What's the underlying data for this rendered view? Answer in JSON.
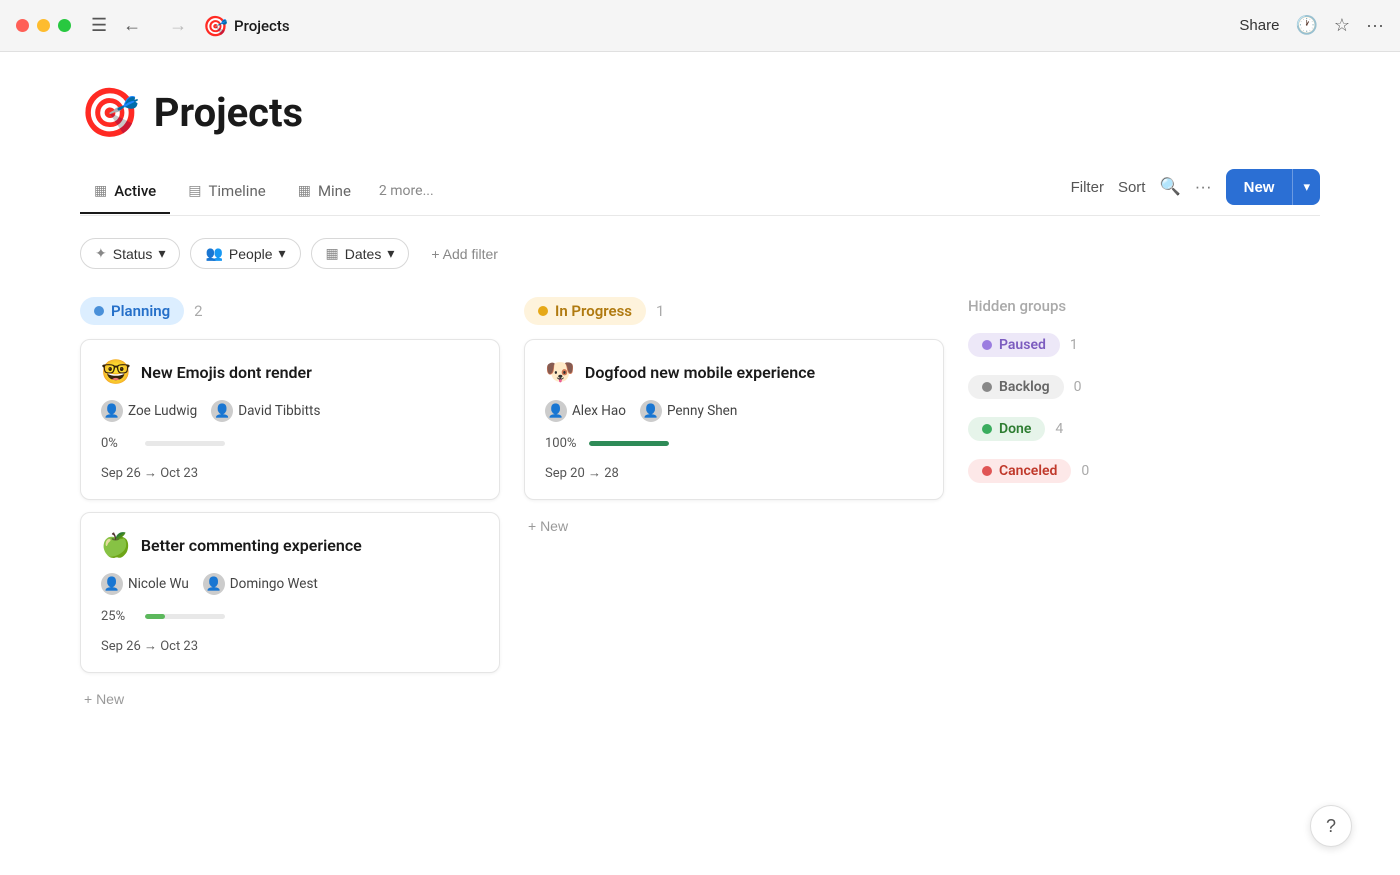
{
  "titlebar": {
    "app_icon": "🎯",
    "title": "Projects",
    "share_label": "Share",
    "history_icon": "🕐",
    "star_icon": "☆",
    "more_icon": "···"
  },
  "page": {
    "icon": "🎯",
    "title": "Projects"
  },
  "tabs": [
    {
      "id": "active",
      "label": "Active",
      "icon": "▦",
      "active": true
    },
    {
      "id": "timeline",
      "label": "Timeline",
      "icon": "▤"
    },
    {
      "id": "mine",
      "label": "Mine",
      "icon": "▦"
    },
    {
      "id": "more",
      "label": "2 more..."
    }
  ],
  "toolbar": {
    "filter_label": "Filter",
    "sort_label": "Sort",
    "search_icon": "🔍",
    "more_icon": "···",
    "new_label": "New",
    "chevron": "▾"
  },
  "filters": {
    "status_label": "Status",
    "people_label": "People",
    "dates_label": "Dates",
    "add_filter_label": "+ Add filter"
  },
  "columns": [
    {
      "id": "planning",
      "badge_label": "Planning",
      "count": 2,
      "cards": [
        {
          "emoji": "🤓",
          "title": "New Emojis dont  render",
          "people": [
            {
              "name": "Zoe Ludwig",
              "avatar": "👤"
            },
            {
              "name": "David Tibbitts",
              "avatar": "👤"
            }
          ],
          "progress_pct": "0%",
          "progress_class": "fill-0",
          "dates": "Sep 26 → Oct 23"
        },
        {
          "emoji": "🍏",
          "title": "Better commenting experience",
          "people": [
            {
              "name": "Nicole Wu",
              "avatar": "👤"
            },
            {
              "name": "Domingo West",
              "avatar": "👤"
            }
          ],
          "progress_pct": "25%",
          "progress_class": "fill-25",
          "dates": "Sep 26 → Oct 23"
        }
      ],
      "add_new_label": "+ New"
    },
    {
      "id": "inprogress",
      "badge_label": "In Progress",
      "count": 1,
      "cards": [
        {
          "emoji": "🐶",
          "title": "Dogfood new mobile experience",
          "people": [
            {
              "name": "Alex Hao",
              "avatar": "👤"
            },
            {
              "name": "Penny Shen",
              "avatar": "👤"
            }
          ],
          "progress_pct": "100%",
          "progress_class": "fill-100",
          "dates": "Sep 20 → 28"
        }
      ],
      "add_new_label": "+ New"
    }
  ],
  "hidden_groups": {
    "title": "Hidden groups",
    "items": [
      {
        "id": "paused",
        "label": "Paused",
        "count": 1,
        "dot_class": "dot-paused",
        "badge_class": "hg-paused"
      },
      {
        "id": "backlog",
        "label": "Backlog",
        "count": 0,
        "dot_class": "dot-backlog",
        "badge_class": "hg-backlog"
      },
      {
        "id": "done",
        "label": "Done",
        "count": 4,
        "dot_class": "dot-done",
        "badge_class": "hg-done"
      },
      {
        "id": "canceled",
        "label": "Canceled",
        "count": 0,
        "dot_class": "dot-canceled",
        "badge_class": "hg-canceled"
      }
    ]
  },
  "help": {
    "label": "?"
  }
}
